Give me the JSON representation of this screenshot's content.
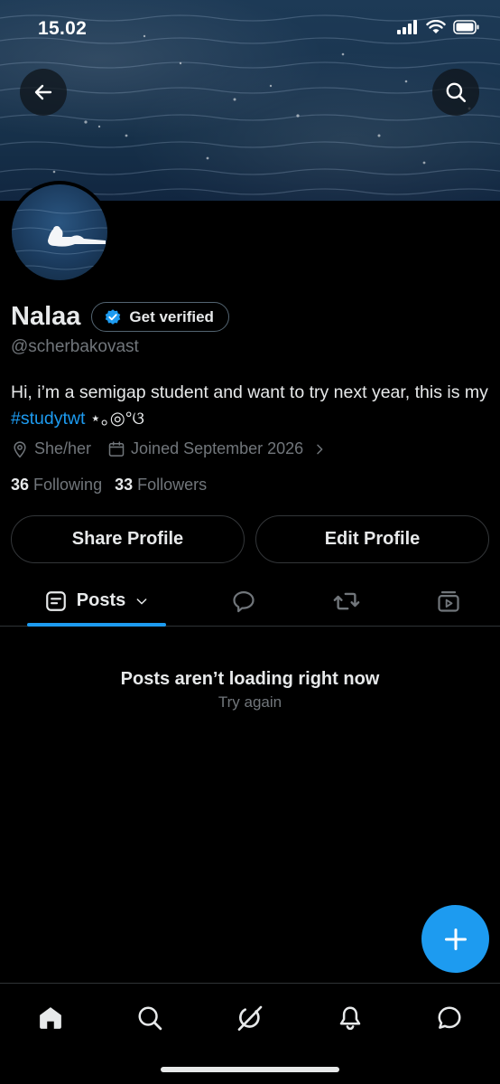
{
  "status_bar": {
    "time": "15.02"
  },
  "header": {
    "back_icon": "arrow-left-icon",
    "search_icon": "search-icon"
  },
  "profile": {
    "display_name": "Nalaa",
    "verify_label": "Get verified",
    "handle": "@scherbakovast",
    "bio_text": "Hi, i’m a semigap student and want to try next year, this is my ",
    "bio_hashtag": "#studytwt",
    "bio_emoji": " ⋆｡◎°ଓ",
    "pronouns": "She/her",
    "joined": "Joined September 2026",
    "following_count": "36",
    "following_label": "Following",
    "followers_count": "33",
    "followers_label": "Followers"
  },
  "actions": {
    "share_label": "Share Profile",
    "edit_label": "Edit Profile"
  },
  "tabs": {
    "posts_label": "Posts",
    "items": [
      "posts-icon",
      "replies-icon",
      "reposts-icon",
      "media-icon"
    ]
  },
  "feed": {
    "empty_title": "Posts aren’t loading right now",
    "retry_label": "Try again"
  },
  "colors": {
    "accent": "#1d9bf0",
    "background": "#000000",
    "text_primary": "#e7e9ea",
    "text_secondary": "#71767b"
  },
  "bottom_nav": [
    "home-icon",
    "search-icon",
    "grok-icon",
    "notifications-icon",
    "messages-icon"
  ]
}
